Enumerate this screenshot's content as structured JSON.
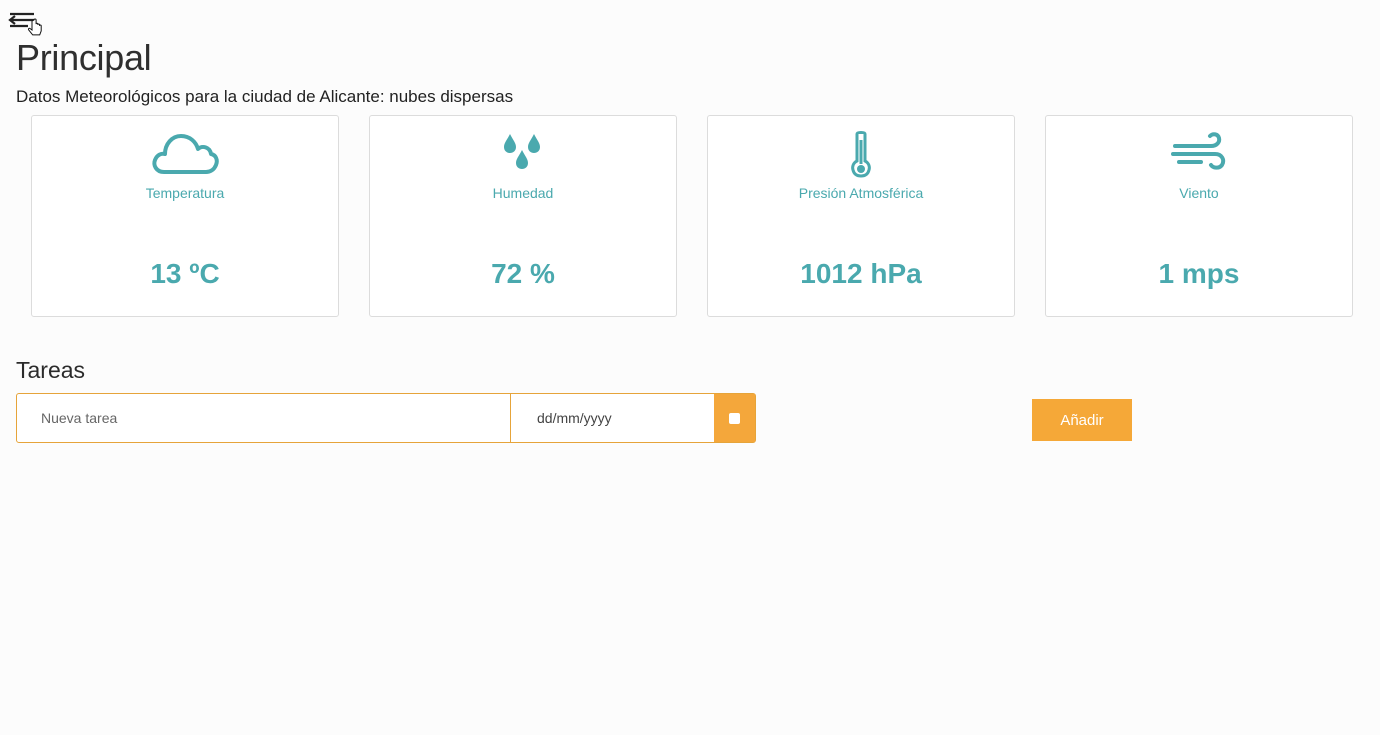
{
  "page": {
    "title": "Principal",
    "weather_subtitle": "Datos Meteorológicos para la ciudad de Alicante: nubes dispersas"
  },
  "weather_cards": [
    {
      "label": "Temperatura",
      "value": "13 ºC",
      "icon": "cloud-icon"
    },
    {
      "label": "Humedad",
      "value": "72 %",
      "icon": "water-drops-icon"
    },
    {
      "label": "Presión Atmosférica",
      "value": "1012 hPa",
      "icon": "thermometer-icon"
    },
    {
      "label": "Viento",
      "value": "1 mps",
      "icon": "wind-icon"
    }
  ],
  "tasks": {
    "title": "Tareas",
    "task_placeholder": "Nueva tarea",
    "date_placeholder": "dd/mm/yyyy",
    "add_label": "Añadir"
  },
  "colors": {
    "accent_teal": "#4aa9ae",
    "accent_orange": "#f5a838",
    "border_orange": "#e6a43a"
  }
}
